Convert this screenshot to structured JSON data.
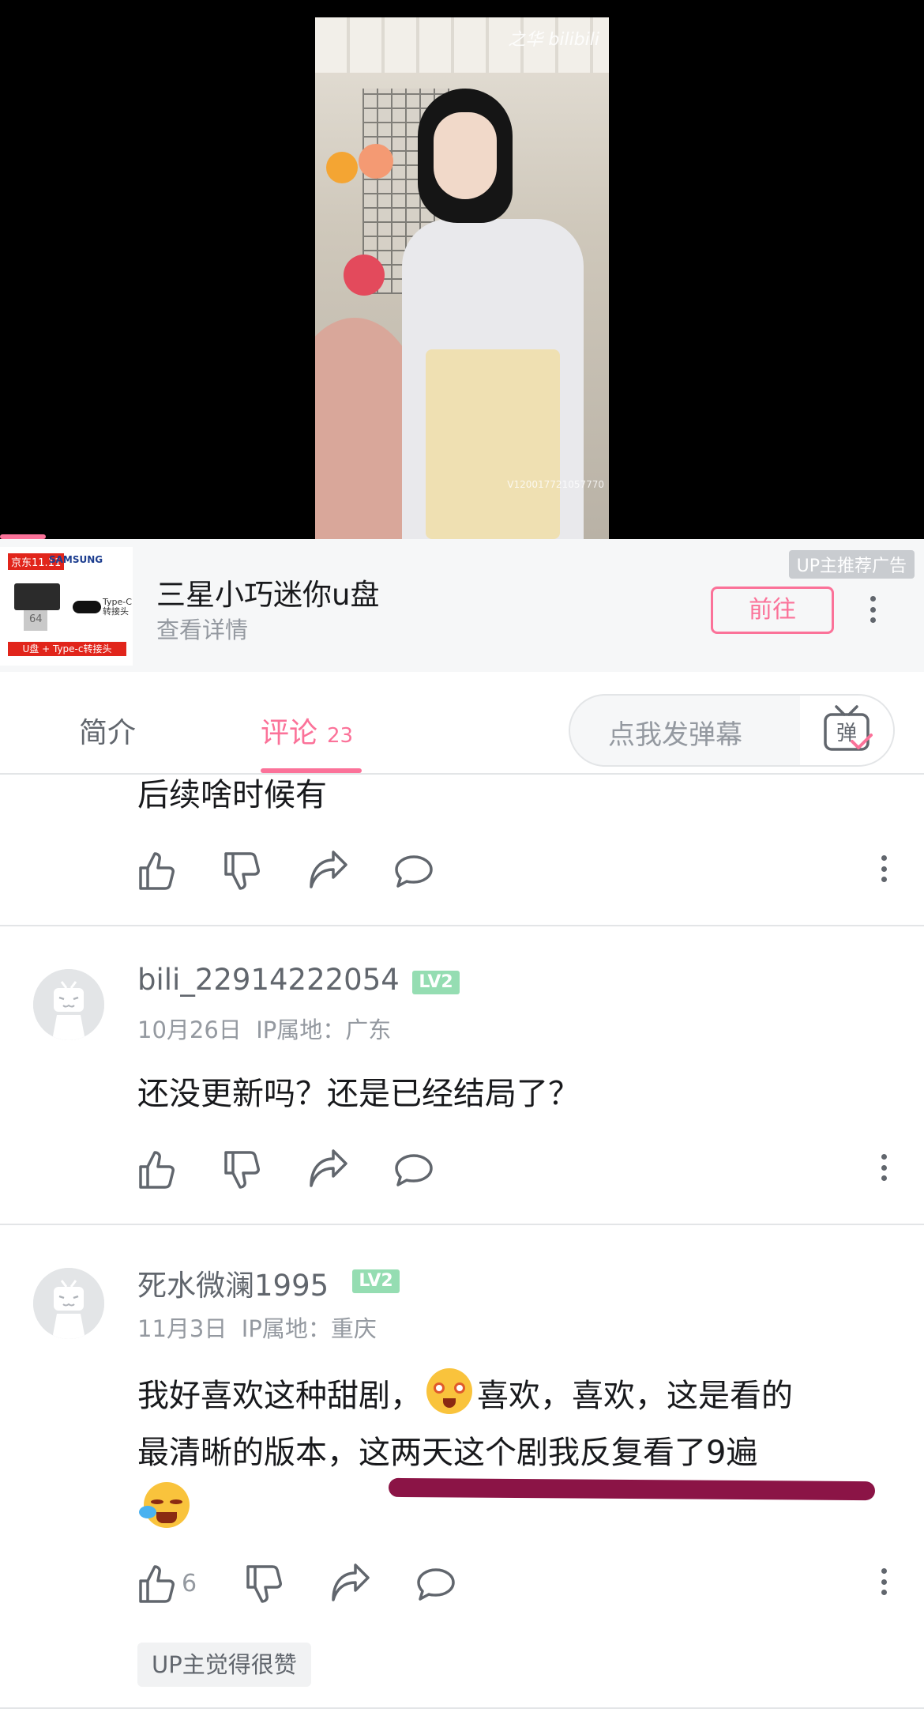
{
  "video": {
    "watermark": "之华 bilibili",
    "watermark_id": "V120017721057770"
  },
  "ad": {
    "thumb_tag": "京东11.11",
    "thumb_brand": "SAMSUNG",
    "thumb_usb_number": "64",
    "thumb_typec": "Type-C 转接头",
    "thumb_strip": "U盘 + Type-c转接头",
    "title": "三星小巧迷你u盘",
    "subtitle": "查看详情",
    "label": "UP主推荐广告",
    "go_button": "前往"
  },
  "tabs": {
    "intro": "简介",
    "comments": "评论",
    "comments_count": "23",
    "danmaku_placeholder": "点我发弹幕",
    "danmaku_button": "弹"
  },
  "comments": [
    {
      "text": "后续啥时候有"
    },
    {
      "username": "bili_22914222054",
      "level": "LV2",
      "date": "10月26日",
      "location": "IP属地：广东",
      "text": "还没更新吗？还是已经结局了？"
    },
    {
      "username": "死水微澜1995",
      "level": "LV2",
      "date": "11月3日",
      "location": "IP属地：重庆",
      "text_part1": "我好喜欢这种甜剧，",
      "text_part2": "喜欢，喜欢，这是看的",
      "text_part3": "最清晰的版本，这两天这个剧我反复看了9遍",
      "likes": "6",
      "badge": "UP主觉得很赞"
    }
  ],
  "colors": {
    "accent": "#fb7299",
    "level_badge": "#95ddb2",
    "annotation": "#8b1446"
  }
}
